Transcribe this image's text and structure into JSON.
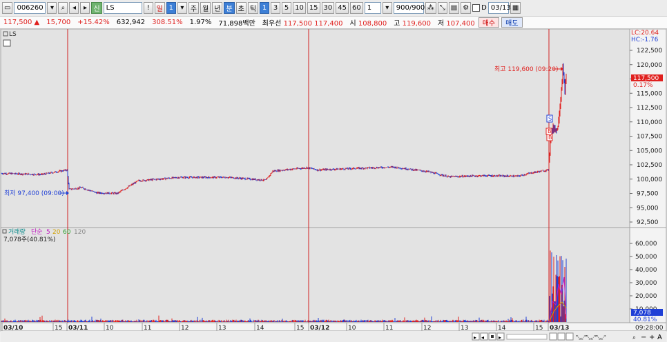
{
  "toolbar": {
    "code": "006260",
    "badge": "신",
    "name": "LS",
    "period_buttons": [
      "일",
      "1",
      "주",
      "월",
      "년",
      "분",
      "초",
      "틱"
    ],
    "interval_buttons": [
      "1",
      "3",
      "5",
      "10",
      "15",
      "30",
      "45",
      "60"
    ],
    "interval_value": "1",
    "count_value": "900/900",
    "d_label": "D",
    "date_value": "03/13"
  },
  "quote": {
    "price": "117,500",
    "change": "15,700",
    "change_pct": "+15.42%",
    "volume": "632,942",
    "volume_ratio": "308.51%",
    "turnover": "1.97%",
    "amount": "71,898백만",
    "best_label": "최우선",
    "best_ask": "117,500",
    "best_bid": "117,400",
    "open_label": "시",
    "open": "108,800",
    "high_label": "고",
    "high": "119,600",
    "low_label": "저",
    "low": "107,400",
    "buy_label": "매수",
    "sell_label": "매도"
  },
  "chart": {
    "symbol_label": "LS",
    "lc": "LC:20.64",
    "hc": "HC:-1.76",
    "price_axis": [
      "122,500",
      "120,000",
      "117,500",
      "115,000",
      "112,500",
      "110,000",
      "107,500",
      "105,000",
      "102,500",
      "100,000",
      "97,500",
      "95,000",
      "92,500"
    ],
    "current_price_tag": "117,500",
    "current_pct_tag": "0.17%",
    "high_annotation": "최고 119,600 (09:20)",
    "low_annotation": "최저 97,400 (09:00)",
    "volume_legend": {
      "name": "거래량",
      "ma_label": "단순",
      "periods": [
        "5",
        "20",
        "60",
        "120"
      ],
      "value": "7,078주(40.81%)"
    },
    "volume_axis": [
      "60,000",
      "50,000",
      "40,000",
      "30,000",
      "20,000",
      "10,000"
    ],
    "volume_tag": "7,078",
    "volume_pct_tag": "40.81%",
    "time_axis": [
      "03/10",
      "15",
      "03/11",
      "10",
      "11",
      "12",
      "13",
      "14",
      "15",
      "03/12",
      "10",
      "11",
      "12",
      "13",
      "14",
      "15",
      "03/13"
    ],
    "time_readout": "09:28:00",
    "markers": [
      "S",
      "B",
      "B"
    ]
  },
  "colors": {
    "up": "#e0201e",
    "down": "#1f3fd6",
    "panel_bg": "#e3e3e3",
    "divider": "#d02020"
  },
  "chart_data": {
    "type": "candlestick",
    "price_ylim": [
      92500,
      122500
    ],
    "volume_ylim": [
      0,
      60000
    ],
    "high": 119600,
    "low": 97400,
    "last": 117500
  }
}
